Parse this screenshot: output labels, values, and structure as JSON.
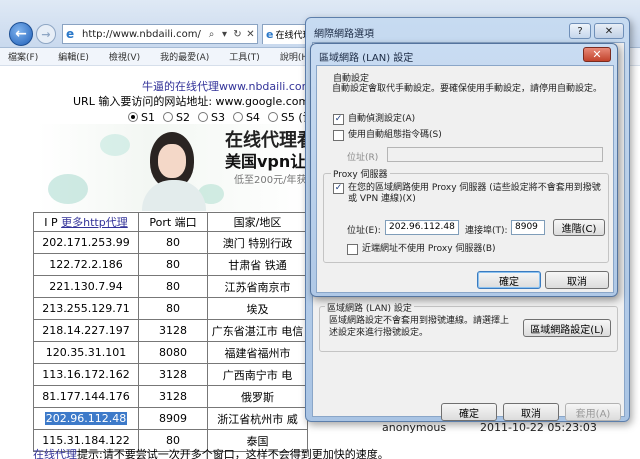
{
  "browser": {
    "address_url": "http://www.nbdaili.com/",
    "tab_title": "在线代理",
    "menu": [
      "檔案(F)",
      "編輯(E)",
      "檢視(V)",
      "我的最愛(A)",
      "工具(T)",
      "說明(H)"
    ]
  },
  "page": {
    "site_title": "牛逼的在线代理www.nbdaili.com",
    "url_prompt": "URL 输入要访问的网站地址: www.google.com",
    "server_options": [
      "S1",
      "S2",
      "S3",
      "S4",
      "S5 (请"
    ],
    "selected_server": "S1",
    "banner": {
      "line1": "在线代理看",
      "line2": "美国vpn让",
      "line3": "低至200元/年获"
    },
    "table": {
      "headers": [
        "I P ",
        "更多http代理",
        "Port 端口",
        "国家/地区"
      ],
      "rows": [
        [
          "202.171.253.99",
          "80",
          "澳门 特别行政"
        ],
        [
          "122.72.2.186",
          "80",
          "甘肃省 铁通"
        ],
        [
          "221.130.7.94",
          "80",
          "江苏省南京市"
        ],
        [
          "213.255.129.71",
          "80",
          "埃及"
        ],
        [
          "218.14.227.197",
          "3128",
          "广东省湛江市 电信"
        ],
        [
          "120.35.31.101",
          "8080",
          "福建省福州市"
        ],
        [
          "113.16.172.162",
          "3128",
          "广西南宁市 电"
        ],
        [
          "81.177.144.176",
          "3128",
          "俄罗斯"
        ],
        [
          "202.96.112.48",
          "8909",
          "浙江省杭州市 威"
        ],
        [
          "115.31.184.122",
          "80",
          "泰国"
        ]
      ],
      "highlighted_ip": "202.96.112.48"
    },
    "bg_row": {
      "type": "anonymous",
      "date": "2011-10-22 05:23:03"
    },
    "footer": {
      "link": "在线代理",
      "text": "提示:请不要尝试一次开多个窗口，这样不会得到更加快的速度。"
    }
  },
  "internet_options": {
    "title": "網際網路選項",
    "help_btn": "?",
    "close_btn": "✕",
    "lan_group_label": "區域網路 (LAN) 設定",
    "lan_desc": "區域網路設定不會套用到撥號連線。請選擇上述設定來進行撥號設定。",
    "lan_settings_btn": "區域網路設定(L)",
    "ok": "確定",
    "cancel": "取消",
    "apply": "套用(A)"
  },
  "lan_dialog": {
    "title": "區域網路 (LAN) 設定",
    "close_btn": "✕",
    "auto_group": "自動設定",
    "auto_desc": "自動設定會取代手動設定。要確保使用手動設定，請停用自動設定。",
    "auto_detect": {
      "label": "自動偵測設定(A)",
      "checked": true
    },
    "auto_script": {
      "label": "使用自動組態指令碼(S)",
      "checked": false
    },
    "address_label": "位址(R)",
    "address_value": "",
    "proxy_group": "Proxy 伺服器",
    "use_proxy": {
      "label": "在您的區域網路使用 Proxy 伺服器 (這些設定將不會套用到撥號或 VPN 連線)(X)",
      "checked": true
    },
    "proxy_address_label": "位址(E):",
    "proxy_address": "202.96.112.48",
    "port_label": "連接埠(T):",
    "port": "8909",
    "advanced_btn": "進階(C)",
    "bypass_local": {
      "label": "近端網址不使用 Proxy 伺服器(B)",
      "checked": false
    },
    "ok": "確定",
    "cancel": "取消"
  }
}
